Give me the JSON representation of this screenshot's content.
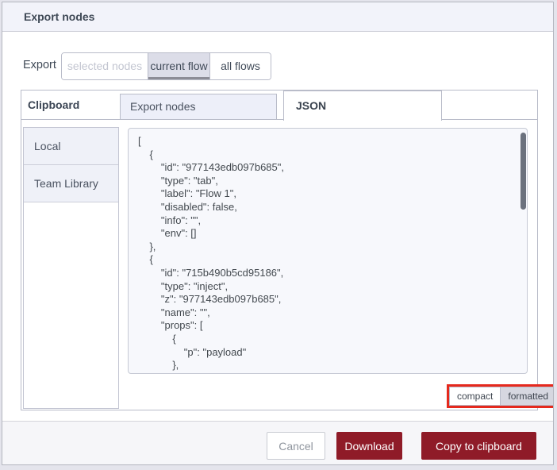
{
  "dialog": {
    "title": "Export nodes"
  },
  "export_row": {
    "label": "Export",
    "options": [
      {
        "label": "selected nodes",
        "state": "disabled"
      },
      {
        "label": "current flow",
        "state": "selected"
      },
      {
        "label": "all flows",
        "state": "normal"
      }
    ]
  },
  "library": {
    "heading": "Clipboard",
    "items": [
      {
        "label": "Local"
      },
      {
        "label": "Team Library"
      }
    ]
  },
  "tabs": [
    {
      "label": "Export nodes",
      "active": false
    },
    {
      "label": "JSON",
      "active": true
    }
  ],
  "editor": {
    "code": "[\n    {\n        \"id\": \"977143edb097b685\",\n        \"type\": \"tab\",\n        \"label\": \"Flow 1\",\n        \"disabled\": false,\n        \"info\": \"\",\n        \"env\": []\n    },\n    {\n        \"id\": \"715b490b5cd95186\",\n        \"type\": \"inject\",\n        \"z\": \"977143edb097b685\",\n        \"name\": \"\",\n        \"props\": [\n            {\n                \"p\": \"payload\"\n            },",
    "format_toggle": {
      "options": [
        {
          "label": "compact",
          "selected": false
        },
        {
          "label": "formatted",
          "selected": true
        }
      ],
      "annotation_color": "#e5291d"
    }
  },
  "footer": {
    "cancel_label": "Cancel",
    "download_label": "Download",
    "copy_label": "Copy to clipboard"
  },
  "colors": {
    "primary_button": "#8f1b28",
    "header_bg": "#f2f3fa",
    "selected_option_bg": "#dcdde8",
    "annotation_red": "#e5291d"
  }
}
